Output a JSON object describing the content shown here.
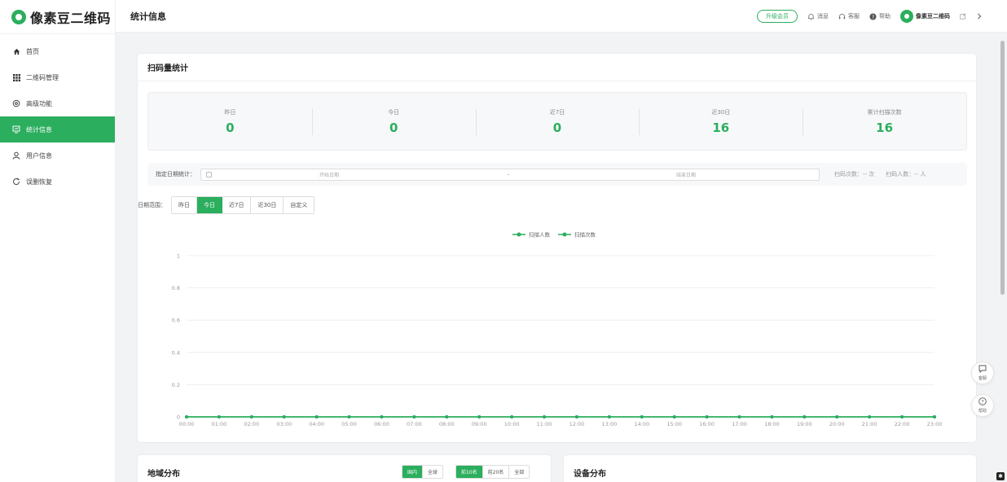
{
  "app": {
    "name": "像素豆二维码",
    "page_title": "统计信息"
  },
  "sidebar": {
    "items": [
      {
        "label": "首页",
        "icon": "home-icon"
      },
      {
        "label": "二维码管理",
        "icon": "grid-icon"
      },
      {
        "label": "高级功能",
        "icon": "settings-icon"
      },
      {
        "label": "统计信息",
        "icon": "stats-icon",
        "active": true
      },
      {
        "label": "用户信息",
        "icon": "user-icon"
      },
      {
        "label": "误删恢复",
        "icon": "restore-icon"
      }
    ]
  },
  "topbar": {
    "upgrade": "升级会员",
    "message": "消息",
    "service": "客服",
    "help": "帮助",
    "user": "像素豆二维码"
  },
  "scan_card": {
    "title": "扫码量统计",
    "stats": [
      {
        "label": "昨日",
        "value": "0"
      },
      {
        "label": "今日",
        "value": "0"
      },
      {
        "label": "近7日",
        "value": "0"
      },
      {
        "label": "近30日",
        "value": "16"
      },
      {
        "label": "累计扫描次数",
        "value": "16"
      }
    ],
    "date_filter": {
      "label": "指定日期统计：",
      "start_placeholder": "开始日期",
      "separator": "-",
      "end_placeholder": "结束日期",
      "scan_count": "扫码次数：-- 次",
      "scan_people": "扫码人数：-- 人"
    },
    "range": {
      "label": "日期范围：",
      "options": [
        "昨日",
        "今日",
        "近7日",
        "近30日",
        "自定义"
      ],
      "selected": "今日"
    }
  },
  "chart_data": {
    "type": "line",
    "x": [
      "00:00",
      "01:00",
      "02:00",
      "03:00",
      "04:00",
      "05:00",
      "06:00",
      "07:00",
      "08:00",
      "09:00",
      "10:00",
      "11:00",
      "12:00",
      "13:00",
      "14:00",
      "15:00",
      "16:00",
      "17:00",
      "18:00",
      "19:00",
      "20:00",
      "21:00",
      "22:00",
      "23:00"
    ],
    "series": [
      {
        "name": "扫描人数",
        "values": [
          0,
          0,
          0,
          0,
          0,
          0,
          0,
          0,
          0,
          0,
          0,
          0,
          0,
          0,
          0,
          0,
          0,
          0,
          0,
          0,
          0,
          0,
          0,
          0
        ]
      },
      {
        "name": "扫描次数",
        "values": [
          0,
          0,
          0,
          0,
          0,
          0,
          0,
          0,
          0,
          0,
          0,
          0,
          0,
          0,
          0,
          0,
          0,
          0,
          0,
          0,
          0,
          0,
          0,
          0
        ]
      }
    ],
    "yticks": [
      "0",
      "0.2",
      "0.4",
      "0.6",
      "0.8",
      "1"
    ],
    "ylim": [
      0,
      1
    ],
    "legend": "top-center",
    "grid": true,
    "color": "#2bae5d"
  },
  "region_card": {
    "title": "地域分布",
    "scope_tags": [
      "国内",
      "全球"
    ],
    "top_tags": [
      "前10名",
      "前20名",
      "全部"
    ]
  },
  "device_card": {
    "title": "设备分布"
  },
  "float_buttons": {
    "service": "客服",
    "help": "帮助"
  },
  "colors": {
    "accent": "#2bae5d"
  }
}
